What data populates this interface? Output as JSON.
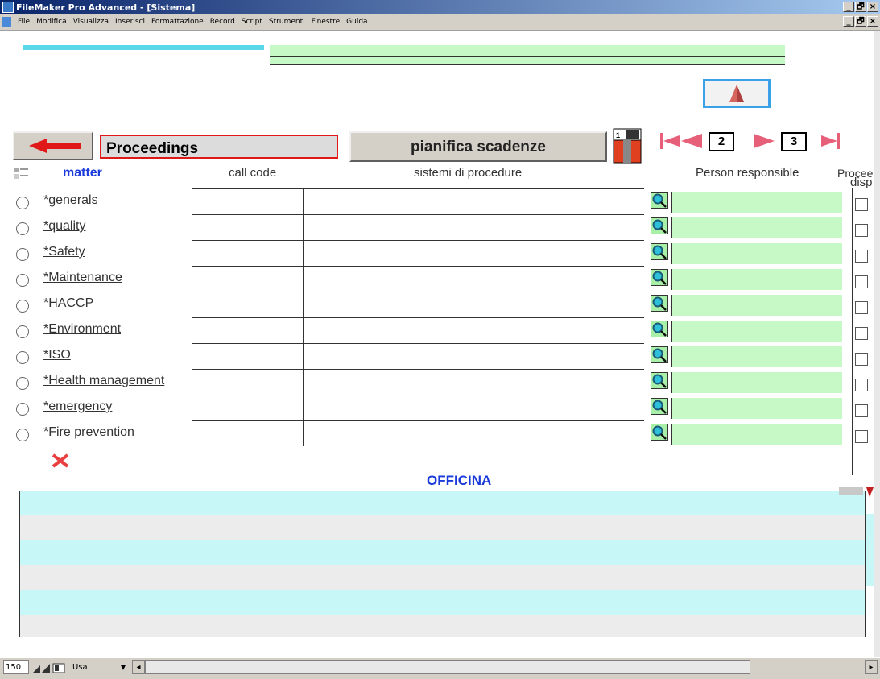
{
  "window": {
    "title": "FileMaker Pro Advanced - [Sistema]",
    "buttons": [
      "_",
      "🗗",
      "×"
    ],
    "doc_buttons": [
      "_",
      "🗗",
      "×"
    ]
  },
  "menu": [
    "File",
    "Modifica",
    "Visualizza",
    "Inserisci",
    "Formattazione",
    "Record",
    "Script",
    "Strumenti",
    "Finestre",
    "Guida"
  ],
  "toolbar": {
    "title": "Proceedings",
    "plan_button": "pianifica scadenze",
    "page_left": "2",
    "page_right": "3"
  },
  "columns": {
    "matter": "matter",
    "call_code": "call code",
    "systems": "sistemi di procedure",
    "person": "Person responsible",
    "disp1": "disp",
    "disp2": "Procee"
  },
  "rows": [
    {
      "label": " *generals",
      "code": "",
      "system": "",
      "person": ""
    },
    {
      "label": " *quality",
      "code": "",
      "system": "",
      "person": ""
    },
    {
      "label": "*Safety",
      "code": "",
      "system": "",
      "person": ""
    },
    {
      "label": " *Maintenance",
      "code": "",
      "system": "",
      "person": ""
    },
    {
      "label": "*HACCP",
      "code": "",
      "system": "",
      "person": ""
    },
    {
      "label": "*Environment",
      "code": "",
      "system": "",
      "person": ""
    },
    {
      "label": "*ISO",
      "code": "",
      "system": "",
      "person": ""
    },
    {
      "label": " *Health management",
      "code": "",
      "system": "",
      "person": ""
    },
    {
      "label": "*emergency",
      "code": "",
      "system": "",
      "person": ""
    },
    {
      "label": "*Fire prevention",
      "code": "",
      "system": "",
      "person": ""
    }
  ],
  "section": {
    "title": "OFFICINA"
  },
  "status": {
    "zoom": "150",
    "mode": "Usa"
  },
  "colors": {
    "accent_red": "#e02020",
    "field_green": "#c6f9c6",
    "band_cyan": "#c8f7f7",
    "band_gray": "#ececec",
    "title_blue": "#1a3adb"
  }
}
